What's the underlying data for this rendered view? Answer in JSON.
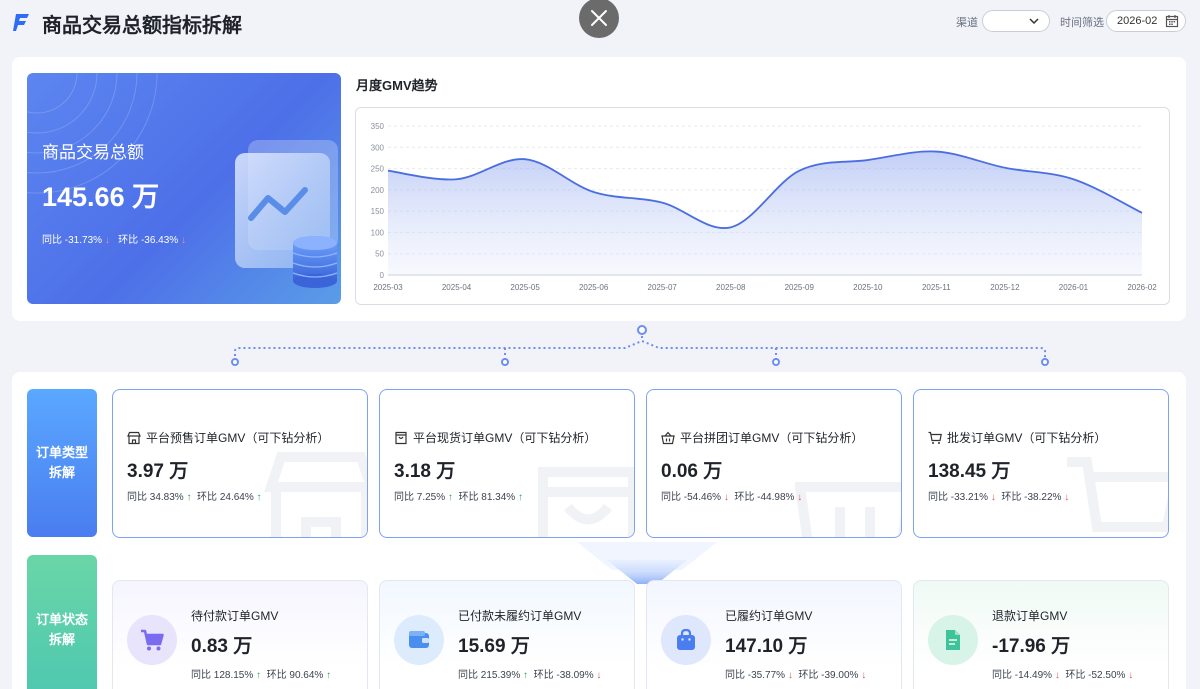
{
  "header": {
    "title": "商品交易总额指标拆解",
    "channel_label": "渠道",
    "channel_value": "",
    "time_label": "时间筛选",
    "time_value": "2026-02"
  },
  "kpi": {
    "title": "商品交易总额",
    "value": "145.66 万",
    "yoy_label": "同比",
    "yoy_value": "-31.73%",
    "mom_label": "环比",
    "mom_value": "-36.43%"
  },
  "chart_title": "月度GMV趋势",
  "chart_data": {
    "type": "area",
    "title": "月度GMV趋势",
    "x": [
      "2025-03",
      "2025-04",
      "2025-05",
      "2025-06",
      "2025-07",
      "2025-08",
      "2025-09",
      "2025-10",
      "2025-11",
      "2025-12",
      "2026-01",
      "2026-02"
    ],
    "y": [
      245,
      225,
      272,
      195,
      170,
      112,
      245,
      270,
      290,
      252,
      225,
      146
    ],
    "ylim": [
      0,
      350
    ],
    "yticks": [
      0,
      50,
      100,
      150,
      200,
      250,
      300,
      350
    ],
    "grid": true,
    "color": "#4a6ee0"
  },
  "order_type": {
    "tag": "订单类型拆解",
    "tag_line1": "订单类型",
    "tag_line2": "拆解",
    "cards": [
      {
        "label": "平台预售订单GMV（可下钻分析）",
        "value": "3.97 万",
        "yoy": "同比 34.83%",
        "yoy_dir": "up",
        "mom": "环比 24.64%",
        "mom_dir": "up",
        "icon": "store-icon"
      },
      {
        "label": "平台现货订单GMV（可下钻分析）",
        "value": "3.18 万",
        "yoy": "同比 7.25%",
        "yoy_dir": "up",
        "mom": "环比 81.34%",
        "mom_dir": "up",
        "icon": "bag-icon"
      },
      {
        "label": "平台拼团订单GMV（可下钻分析）",
        "value": "0.06 万",
        "yoy": "同比 -54.46%",
        "yoy_dir": "down",
        "mom": "环比 -44.98%",
        "mom_dir": "down",
        "icon": "basket-icon"
      },
      {
        "label": "批发订单GMV（可下钻分析）",
        "value": "138.45 万",
        "yoy": "同比 -33.21%",
        "yoy_dir": "down",
        "mom": "环比 -38.22%",
        "mom_dir": "down",
        "icon": "cart-icon"
      }
    ]
  },
  "order_status": {
    "tag_line1": "订单状态",
    "tag_line2": "拆解",
    "cards": [
      {
        "label": "待付款订单GMV",
        "value": "0.83 万",
        "yoy": "同比 128.15%",
        "yoy_dir": "up",
        "mom": "环比 90.64%",
        "mom_dir": "up",
        "icon": "cart-icon",
        "color": "#7a6cf0"
      },
      {
        "label": "已付款未履约订单GMV",
        "value": "15.69 万",
        "yoy": "同比 215.39%",
        "yoy_dir": "up",
        "mom": "环比 -38.09%",
        "mom_dir": "down",
        "icon": "wallet-icon",
        "color": "#4a8ff0"
      },
      {
        "label": "已履约订单GMV",
        "value": "147.10 万",
        "yoy": "同比 -35.77%",
        "yoy_dir": "down",
        "mom": "环比 -39.00%",
        "mom_dir": "down",
        "icon": "shopping-bag-icon",
        "color": "#4a7ef0"
      },
      {
        "label": "退款订单GMV",
        "value": "-17.96 万",
        "yoy": "同比 -14.49%",
        "yoy_dir": "down",
        "mom": "环比 -52.50%",
        "mom_dir": "down",
        "icon": "document-icon",
        "color": "#3ec39a"
      }
    ]
  }
}
